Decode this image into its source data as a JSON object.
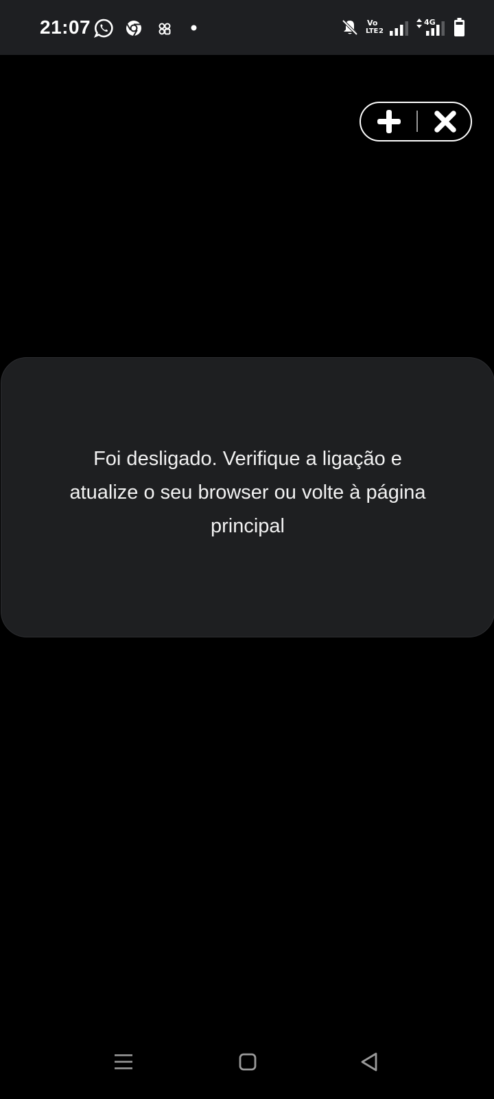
{
  "status_bar": {
    "time": "21:07",
    "left_icons": [
      "whatsapp-icon",
      "chrome-icon",
      "multi-app-icon",
      "notification-dot-icon"
    ],
    "right_icons": [
      "bell-off-icon",
      "volte-icon",
      "signal-icon",
      "data-signal-icon",
      "battery-icon"
    ],
    "volte_line1": "Vo",
    "volte_line2": "LTE",
    "sim_number": "2",
    "network_type": "4G"
  },
  "controls": {
    "add_icon": "plus-icon",
    "close_icon": "close-icon"
  },
  "card": {
    "message": "Foi desligado. Verifique a ligação e atualize o seu browser ou volte à página principal"
  },
  "nav_bar": {
    "icons": [
      "recents-icon",
      "home-icon",
      "back-icon"
    ]
  },
  "colors": {
    "background": "#000000",
    "status_bar_bg": "#1e1f22",
    "card_bg": "#1e1f21",
    "text": "#ffffff",
    "nav_icon": "#9a9a9a"
  }
}
